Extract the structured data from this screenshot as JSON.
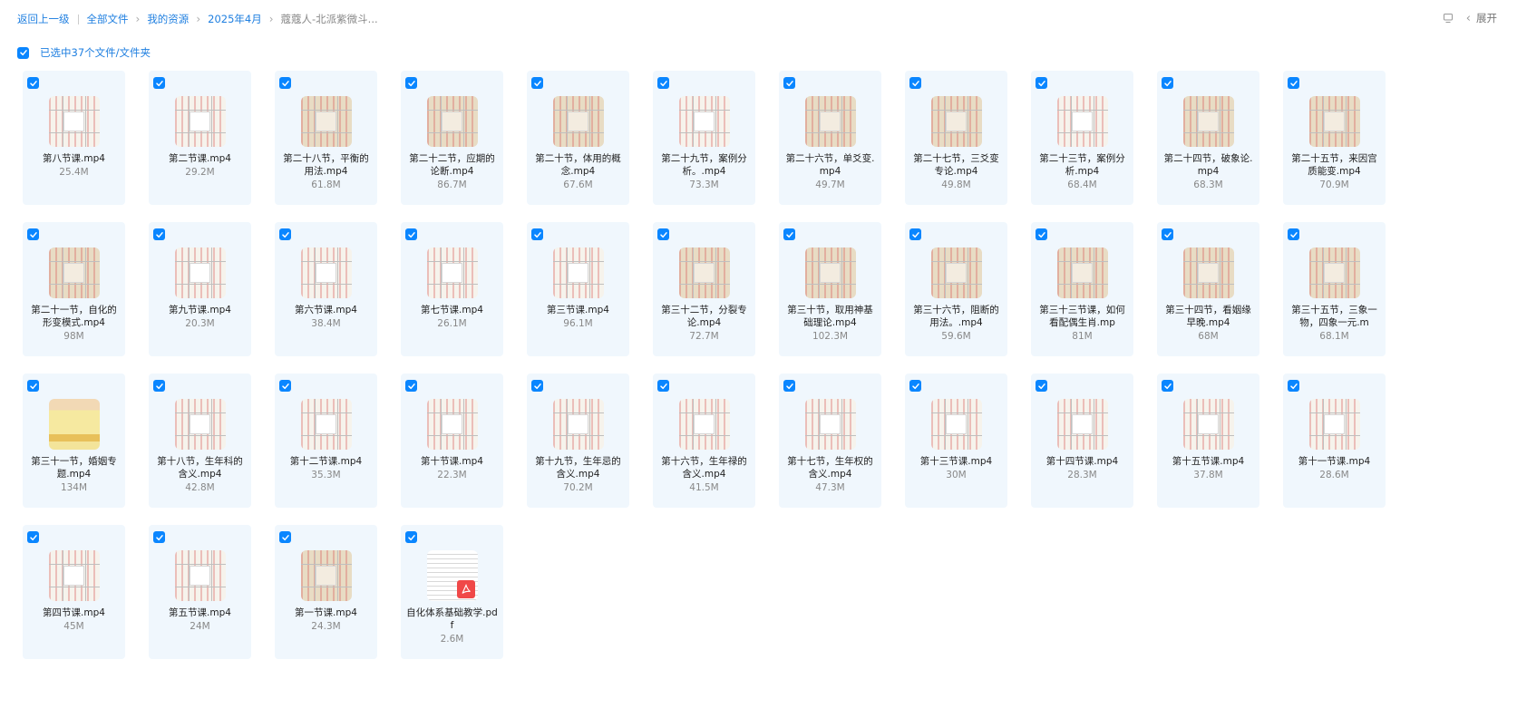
{
  "breadcrumb": {
    "back": "返回上一级",
    "items": [
      "全部文件",
      "我的资源",
      "2025年4月"
    ],
    "current": "蔻蔻人-北派紫微斗..."
  },
  "toolbar": {
    "expand_label": "展开"
  },
  "selection": {
    "label": "已选中37个文件/文件夹"
  },
  "colors": {
    "accent": "#1f7fe0",
    "checkbox": "#0a86ff",
    "card_bg": "#f0f7fd"
  },
  "files": [
    {
      "name": "第八节课.mp4",
      "size": "25.4M",
      "thumb": "grid"
    },
    {
      "name": "第二节课.mp4",
      "size": "29.2M",
      "thumb": "grid"
    },
    {
      "name": "第二十八节，平衡的用法.mp4",
      "size": "61.8M",
      "thumb": "beige"
    },
    {
      "name": "第二十二节，应期的论断.mp4",
      "size": "86.7M",
      "thumb": "beige"
    },
    {
      "name": "第二十节，体用的概念.mp4",
      "size": "67.6M",
      "thumb": "beige"
    },
    {
      "name": "第二十九节，案例分析。.mp4",
      "size": "73.3M",
      "thumb": "grid"
    },
    {
      "name": "第二十六节，单爻变.mp4",
      "size": "49.7M",
      "thumb": "beige"
    },
    {
      "name": "第二十七节，三爻变专论.mp4",
      "size": "49.8M",
      "thumb": "beige"
    },
    {
      "name": "第二十三节，案例分析.mp4",
      "size": "68.4M",
      "thumb": "grid"
    },
    {
      "name": "第二十四节，破象论.mp4",
      "size": "68.3M",
      "thumb": "beige"
    },
    {
      "name": "第二十五节，来因宫质能变.mp4",
      "size": "70.9M",
      "thumb": "beige"
    },
    {
      "name": "第二十一节，自化的形变模式.mp4",
      "size": "98M",
      "thumb": "beige"
    },
    {
      "name": "第九节课.mp4",
      "size": "20.3M",
      "thumb": "grid"
    },
    {
      "name": "第六节课.mp4",
      "size": "38.4M",
      "thumb": "grid"
    },
    {
      "name": "第七节课.mp4",
      "size": "26.1M",
      "thumb": "grid"
    },
    {
      "name": "第三节课.mp4",
      "size": "96.1M",
      "thumb": "grid"
    },
    {
      "name": "第三十二节，分裂专论.mp4",
      "size": "72.7M",
      "thumb": "beige"
    },
    {
      "name": "第三十节，取用神基础理论.mp4",
      "size": "102.3M",
      "thumb": "beige"
    },
    {
      "name": "第三十六节，阻断的用法。.mp4",
      "size": "59.6M",
      "thumb": "beige"
    },
    {
      "name": "第三十三节课，如何看配偶生肖.mp",
      "size": "81M",
      "thumb": "beige"
    },
    {
      "name": "第三十四节，看姻缘早晚.mp4",
      "size": "68M",
      "thumb": "beige"
    },
    {
      "name": "第三十五节，三象一物，四象一元.m",
      "size": "68.1M",
      "thumb": "beige"
    },
    {
      "name": "第三十一节，婚姻专题.mp4",
      "size": "134M",
      "thumb": "colorful"
    },
    {
      "name": "第十八节，生年科的含义.mp4",
      "size": "42.8M",
      "thumb": "grid"
    },
    {
      "name": "第十二节课.mp4",
      "size": "35.3M",
      "thumb": "grid"
    },
    {
      "name": "第十节课.mp4",
      "size": "22.3M",
      "thumb": "grid"
    },
    {
      "name": "第十九节，生年忌的含义.mp4",
      "size": "70.2M",
      "thumb": "grid"
    },
    {
      "name": "第十六节，生年禄的含义.mp4",
      "size": "41.5M",
      "thumb": "grid"
    },
    {
      "name": "第十七节，生年权的含义.mp4",
      "size": "47.3M",
      "thumb": "grid"
    },
    {
      "name": "第十三节课.mp4",
      "size": "30M",
      "thumb": "grid"
    },
    {
      "name": "第十四节课.mp4",
      "size": "28.3M",
      "thumb": "grid"
    },
    {
      "name": "第十五节课.mp4",
      "size": "37.8M",
      "thumb": "grid"
    },
    {
      "name": "第十一节课.mp4",
      "size": "28.6M",
      "thumb": "grid"
    },
    {
      "name": "第四节课.mp4",
      "size": "45M",
      "thumb": "grid"
    },
    {
      "name": "第五节课.mp4",
      "size": "24M",
      "thumb": "grid"
    },
    {
      "name": "第一节课.mp4",
      "size": "24.3M",
      "thumb": "beige"
    },
    {
      "name": "自化体系基础教学.pdf",
      "size": "2.6M",
      "thumb": "pdf"
    }
  ]
}
